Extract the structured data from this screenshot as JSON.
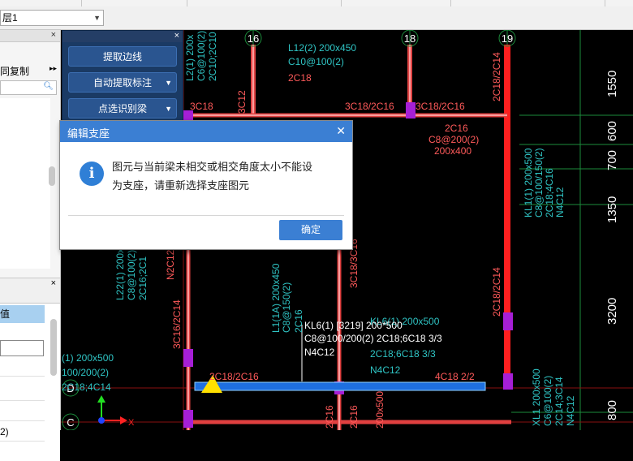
{
  "floor_selector": {
    "value": "层1"
  },
  "left_panel": {
    "copy_label": "同复制",
    "selected_row": "值",
    "row_value": "2)"
  },
  "float_panel": {
    "buttons": [
      {
        "label": "提取边线",
        "has_dropdown": false
      },
      {
        "label": "自动提取标注",
        "has_dropdown": true
      },
      {
        "label": "点选识别梁",
        "has_dropdown": true
      }
    ]
  },
  "dialog": {
    "title": "编辑支座",
    "icon": "info-icon",
    "message_line1": "图元与当前梁未相交或相交角度太小不能设",
    "message_line2": "为支座，请重新选择支座图元",
    "ok_label": "确定"
  },
  "drawing": {
    "axis_labels": {
      "a16": "16",
      "a18": "18",
      "a19": "19",
      "D": "D",
      "C": "C"
    },
    "dimensions": [
      "1550",
      "600",
      "700",
      "1350",
      "3200",
      "800"
    ],
    "texts": {
      "t_l12": "L12(2) 200x450",
      "t_c10": "C10@100(2)",
      "t_2c18": "2C18",
      "t_3c18": "3C18",
      "t_3c18_2c16a": "3C18/2C16",
      "t_3c18_2c16b": "3C18/2C16",
      "t_2c18_2c14": "2C18/2C14",
      "t_2c16": "2C16",
      "t_c8_200": "C8@200(2)",
      "t_200x400": "200x400",
      "t_kl1": "KL1(1) 200x500",
      "t_kl1b": "C8@100/150(2)",
      "t_kl1c": "2C18;4C16",
      "t_n4c12": "N4C12",
      "t_kl6a": "KL6(1) [3219] 200*500",
      "t_kl6b": "C8@100/200(2) 2C18;6C18 3/3",
      "t_kl6c": "N4C12",
      "t_kl_a": "KL6(1) 200x500",
      "t_kl_b": "C8@100/200(2)",
      "t_kl_c": "2C18;6C18 3/3",
      "t_kl_d": "N4C12",
      "t_2c18_2c16": "2C18/2C16",
      "t_4c18": "4C18 2/2",
      "t_l1a": "L1(1A) 200x450",
      "t_l1b": "C8@150(2)",
      "t_l1c": "2C16",
      "t_3c18v": "3C18/3C16",
      "t_3c16_2c14": "3C16/2C14",
      "t_xl1": "XL1 200x500",
      "t_xl1b": "C6@100(2)",
      "t_xl1c": "2C14;3C14",
      "t_xl1d": "N4C12",
      "t_l22": "L22(1) 200x",
      "t_l22b": "C8@100(2)",
      "t_l22c": "2C16;2C1",
      "t_n2c12": "N2C12",
      "t_l200a": "(1) 200x500",
      "t_l200b": "100/200(2)",
      "t_l200c": "2C18;4C14",
      "t_c2c16": "2C16",
      "t_bot1": "2C16",
      "t_bot2": "2C16",
      "t_bot3": "200x500",
      "t_2c18_2c14b": "2C18/2C14",
      "t_2c16v": "2C16",
      "t_l2a": "L2(1) 200x",
      "t_l2b": "C6@100(2)",
      "t_l2c": "2C10;2C10",
      "t_3c12": "3C12",
      "t_ax": "X"
    }
  }
}
